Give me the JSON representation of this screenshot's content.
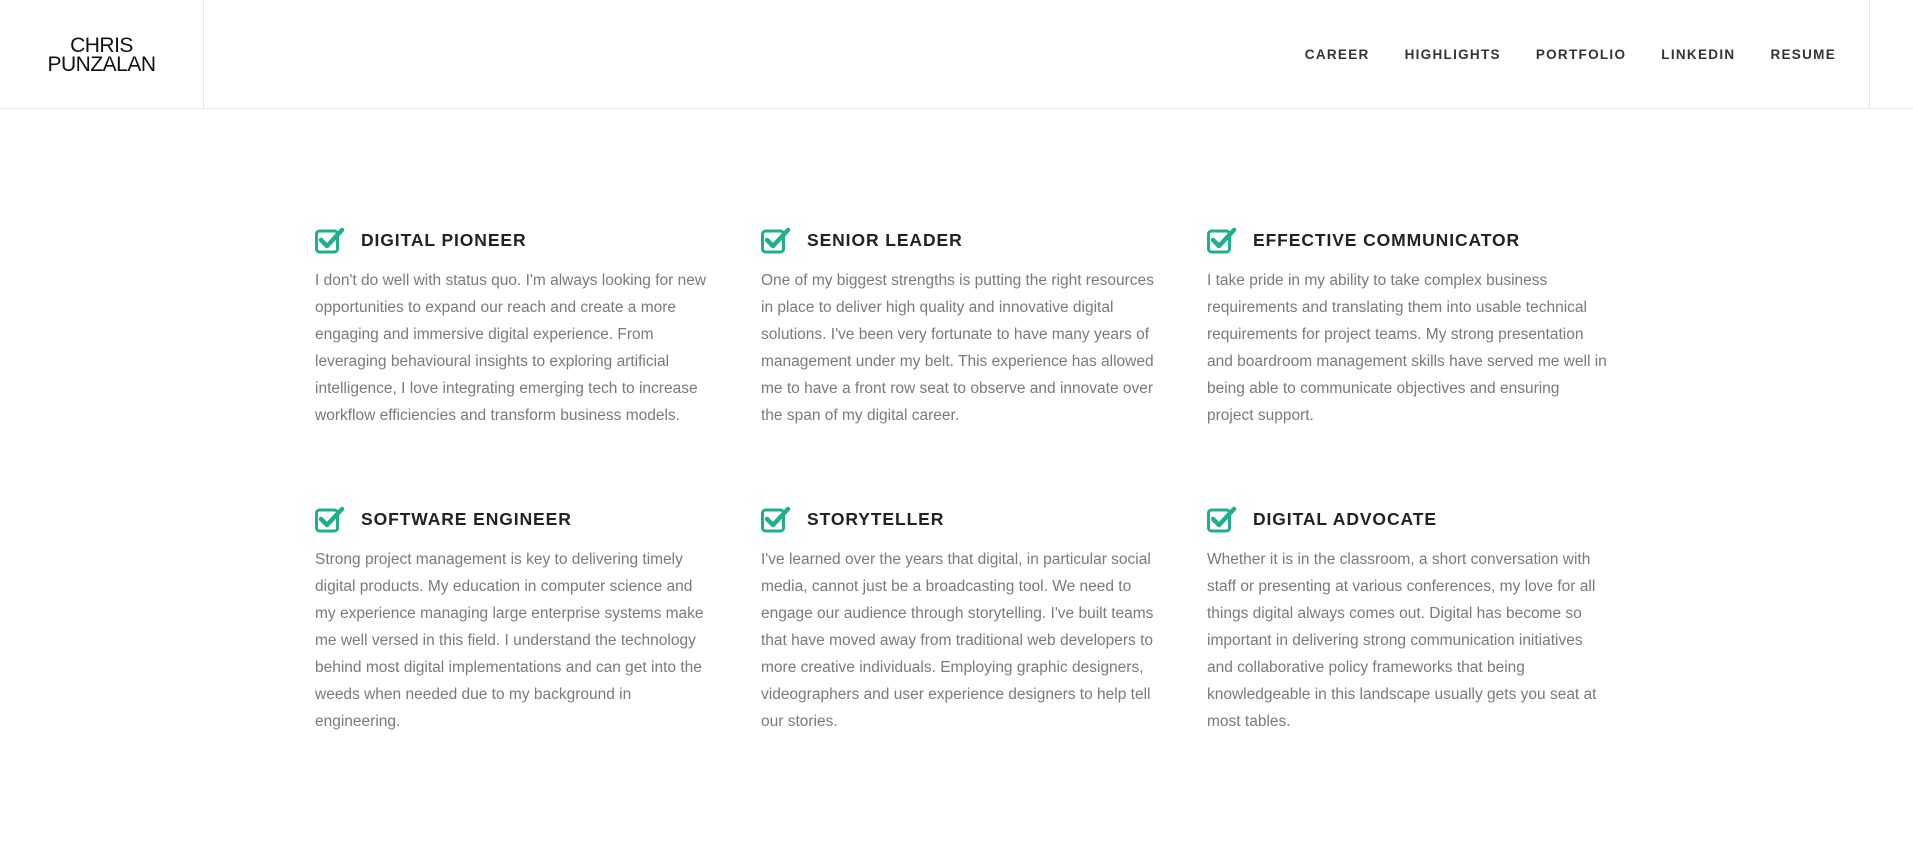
{
  "brand": {
    "line1": "CHRIS",
    "line2": "PUNZALAN"
  },
  "nav": {
    "items": [
      {
        "label": "CAREER"
      },
      {
        "label": "HIGHLIGHTS"
      },
      {
        "label": "PORTFOLIO"
      },
      {
        "label": "LINKEDIN"
      },
      {
        "label": "RESUME"
      }
    ]
  },
  "accent_color": "#1fae8e",
  "cards": [
    {
      "icon": "checkbox-checked-icon",
      "title": "DIGITAL PIONEER",
      "text": "I don't do well with status quo. I'm always looking for new opportunities to expand our reach and create a more engaging and immersive digital experience. From leveraging behavioural insights to exploring artificial intelligence, I love integrating emerging tech to increase workflow efficiencies and transform business models."
    },
    {
      "icon": "checkbox-checked-icon",
      "title": "SENIOR LEADER",
      "text": "One of my biggest strengths is putting the right resources in place to deliver high quality and innovative digital solutions. I've been very fortunate to have many years of management under my belt. This experience has allowed me to have a front row seat to observe and innovate over the span of my digital career."
    },
    {
      "icon": "checkbox-checked-icon",
      "title": "EFFECTIVE COMMUNICATOR",
      "text": "I take pride in my ability to take complex business requirements and translating them into usable technical requirements for project teams. My strong presentation and boardroom management skills have served me well in being able to communicate objectives and ensuring project support."
    },
    {
      "icon": "checkbox-checked-icon",
      "title": "SOFTWARE ENGINEER",
      "text": "Strong project management is key to delivering timely digital products. My education in computer science and my experience managing large enterprise systems make me well versed in this field. I understand the technology behind most digital implementations and can get into the weeds when needed due to my background in engineering."
    },
    {
      "icon": "checkbox-checked-icon",
      "title": "STORYTELLER",
      "text": "I've learned over the years that digital, in particular social media, cannot just be a broadcasting tool. We need to engage our audience through storytelling. I've built teams that have moved away from traditional web developers to more creative individuals. Employing graphic designers, videographers and user experience designers to help tell our stories."
    },
    {
      "icon": "checkbox-checked-icon",
      "title": "DIGITAL ADVOCATE",
      "text": "Whether it is in the classroom, a short conversation with staff or presenting at various conferences, my love for all things digital always comes out. Digital has become so important in delivering strong communication initiatives and collaborative policy frameworks that being knowledgeable in this landscape usually gets you seat at most tables."
    }
  ]
}
